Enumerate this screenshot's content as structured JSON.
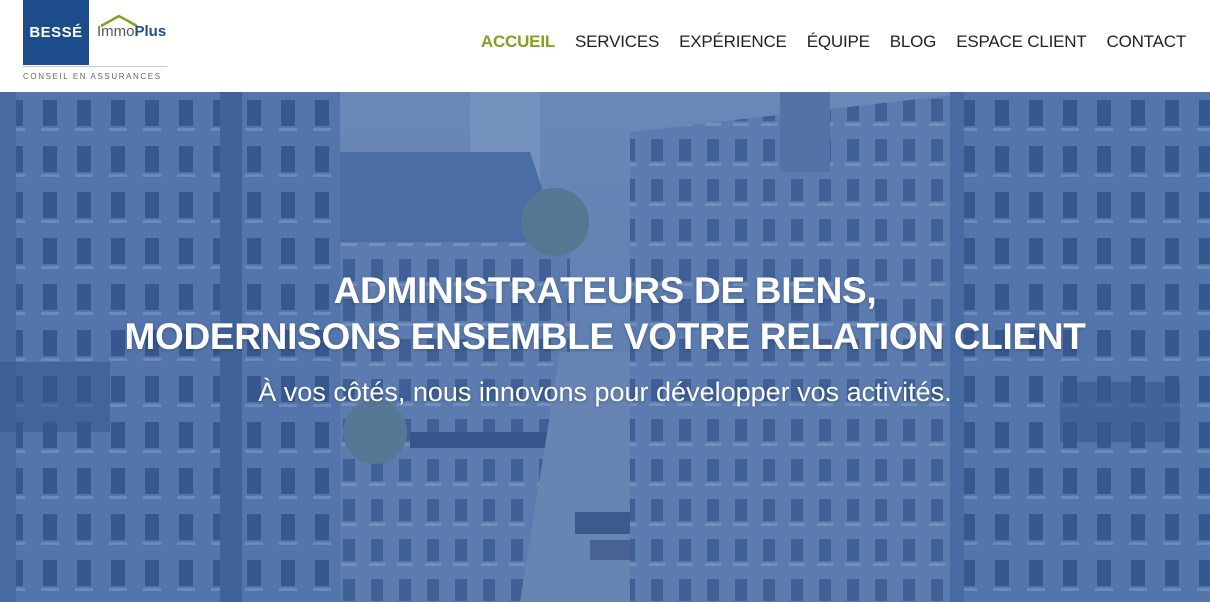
{
  "logo": {
    "brand": "BESSÉ",
    "immo": "Immo",
    "plus": "Plus",
    "tagline": "CONSEIL EN ASSURANCES"
  },
  "nav": {
    "items": [
      {
        "label": "ACCUEIL",
        "active": true
      },
      {
        "label": "SERVICES",
        "active": false
      },
      {
        "label": "EXPÉRIENCE",
        "active": false
      },
      {
        "label": "ÉQUIPE",
        "active": false
      },
      {
        "label": "BLOG",
        "active": false
      },
      {
        "label": "ESPACE CLIENT",
        "active": false
      },
      {
        "label": "CONTACT",
        "active": false
      }
    ]
  },
  "hero": {
    "title_line1": "ADMINISTRATEURS DE BIENS,",
    "title_line2": "MODERNISONS ENSEMBLE VOTRE RELATION CLIENT",
    "subtitle": "À vos côtés, nous innovons pour développer vos activités."
  },
  "colors": {
    "brand_blue": "#1d4c8c",
    "accent_green": "#7fa31f",
    "overlay": "#284e8c"
  }
}
